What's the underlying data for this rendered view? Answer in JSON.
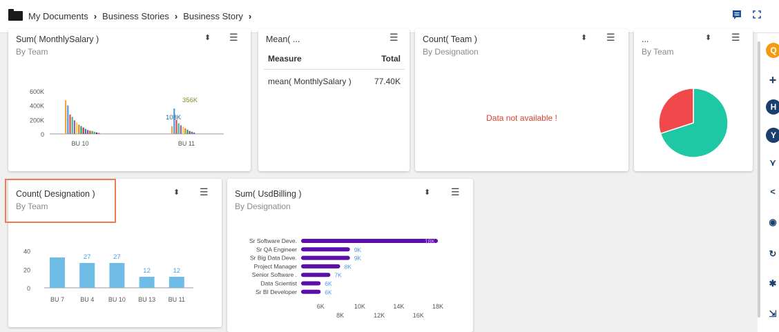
{
  "breadcrumb": [
    "My Documents",
    "Business Stories",
    "Business Story"
  ],
  "panels": {
    "p1": {
      "title": "Sum( MonthlySalary )",
      "subtitle": "By Team"
    },
    "p2": {
      "title": "Mean( ...",
      "table": {
        "headers": [
          "Measure",
          "Total"
        ],
        "rows": [
          [
            "mean( MonthlySalary )",
            "77.40K"
          ]
        ]
      }
    },
    "p3": {
      "title": "Count( Team )",
      "subtitle": "By Designation",
      "message": "Data not available !"
    },
    "p4": {
      "title": "...",
      "subtitle": "By Team"
    },
    "p5": {
      "title": "Count( Designation )",
      "subtitle": "By Team"
    },
    "p6": {
      "title": "Sum( UsdBilling )",
      "subtitle": "By Designation"
    }
  },
  "chart_data": [
    {
      "type": "bar",
      "panel": "Sum( MonthlySalary )",
      "categories": [
        "BU 10",
        "BU 11"
      ],
      "yticks": [
        "600K",
        "400K",
        "200K",
        "0"
      ],
      "ylim": [
        0,
        600000
      ],
      "groups": [
        {
          "category": "BU 10",
          "values": [
            470000,
            400000,
            272000,
            240000,
            190000,
            160000,
            130000,
            110000,
            90000,
            70000,
            55000,
            45000,
            40000,
            30000,
            20000,
            15000
          ]
        },
        {
          "category": "BU 11",
          "values": [
            108000,
            356000,
            198000,
            150000,
            120000,
            100000,
            80000,
            60000,
            40000,
            30000,
            20000
          ]
        }
      ],
      "data_labels": [
        {
          "text": "356K",
          "category": "BU 11"
        },
        {
          "text": "108K",
          "category": "BU 11"
        }
      ]
    },
    {
      "type": "pie",
      "panel": "...",
      "slices": [
        {
          "value": 70,
          "color": "#1ec8a5"
        },
        {
          "value": 30,
          "color": "#f0484b"
        }
      ]
    },
    {
      "type": "bar",
      "panel": "Count( Designation )",
      "categories": [
        "BU 7",
        "BU 4",
        "BU 10",
        "BU 13",
        "BU 11"
      ],
      "values": [
        33,
        27,
        27,
        12,
        12
      ],
      "labels": [
        "",
        "27",
        "27",
        "12",
        "12"
      ],
      "yticks": [
        "40",
        "20",
        "0"
      ],
      "ylim": [
        0,
        45
      ],
      "color": "#6fbce6"
    },
    {
      "type": "bar",
      "orientation": "horizontal",
      "panel": "Sum( UsdBilling )",
      "categories": [
        "Sr Software Deve.",
        "Sr QA Engineer",
        "Sr Big Data Deve.",
        "Project Manager",
        "Senior Software .",
        "Data Scientist",
        "Sr BI Developer"
      ],
      "values": [
        18000,
        9000,
        9000,
        8000,
        7000,
        6000,
        6000
      ],
      "labels": [
        "18K",
        "9K",
        "9K",
        "8K",
        "7K",
        "6K",
        "6K"
      ],
      "xticks_row1": [
        "6K",
        "10K",
        "14K",
        "18K"
      ],
      "xticks_row2": [
        "8K",
        "12K",
        "16K"
      ],
      "xlim": [
        4000,
        18000
      ],
      "color": "#5b0ea8"
    }
  ]
}
